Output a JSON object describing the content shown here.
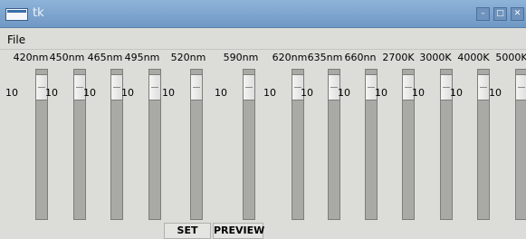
{
  "window": {
    "title": "tk"
  },
  "menu": {
    "file_label": "File"
  },
  "channels": [
    {
      "label": "420nm",
      "value": 10
    },
    {
      "label": "450nm",
      "value": 10
    },
    {
      "label": "465nm",
      "value": 10
    },
    {
      "label": "495nm",
      "value": 10
    },
    {
      "label": "520nm",
      "value": 10
    },
    {
      "label": "590nm",
      "value": 10
    },
    {
      "label": "620nm",
      "value": 10
    },
    {
      "label": "635nm",
      "value": 10
    },
    {
      "label": "660nn",
      "value": 10
    },
    {
      "label": "2700K",
      "value": 10
    },
    {
      "label": "3000K",
      "value": 10
    },
    {
      "label": "4000K",
      "value": 10
    },
    {
      "label": "5000K",
      "value": 10
    }
  ],
  "buttons": {
    "set_label": "SET",
    "preview_label": "PREVIEW"
  }
}
